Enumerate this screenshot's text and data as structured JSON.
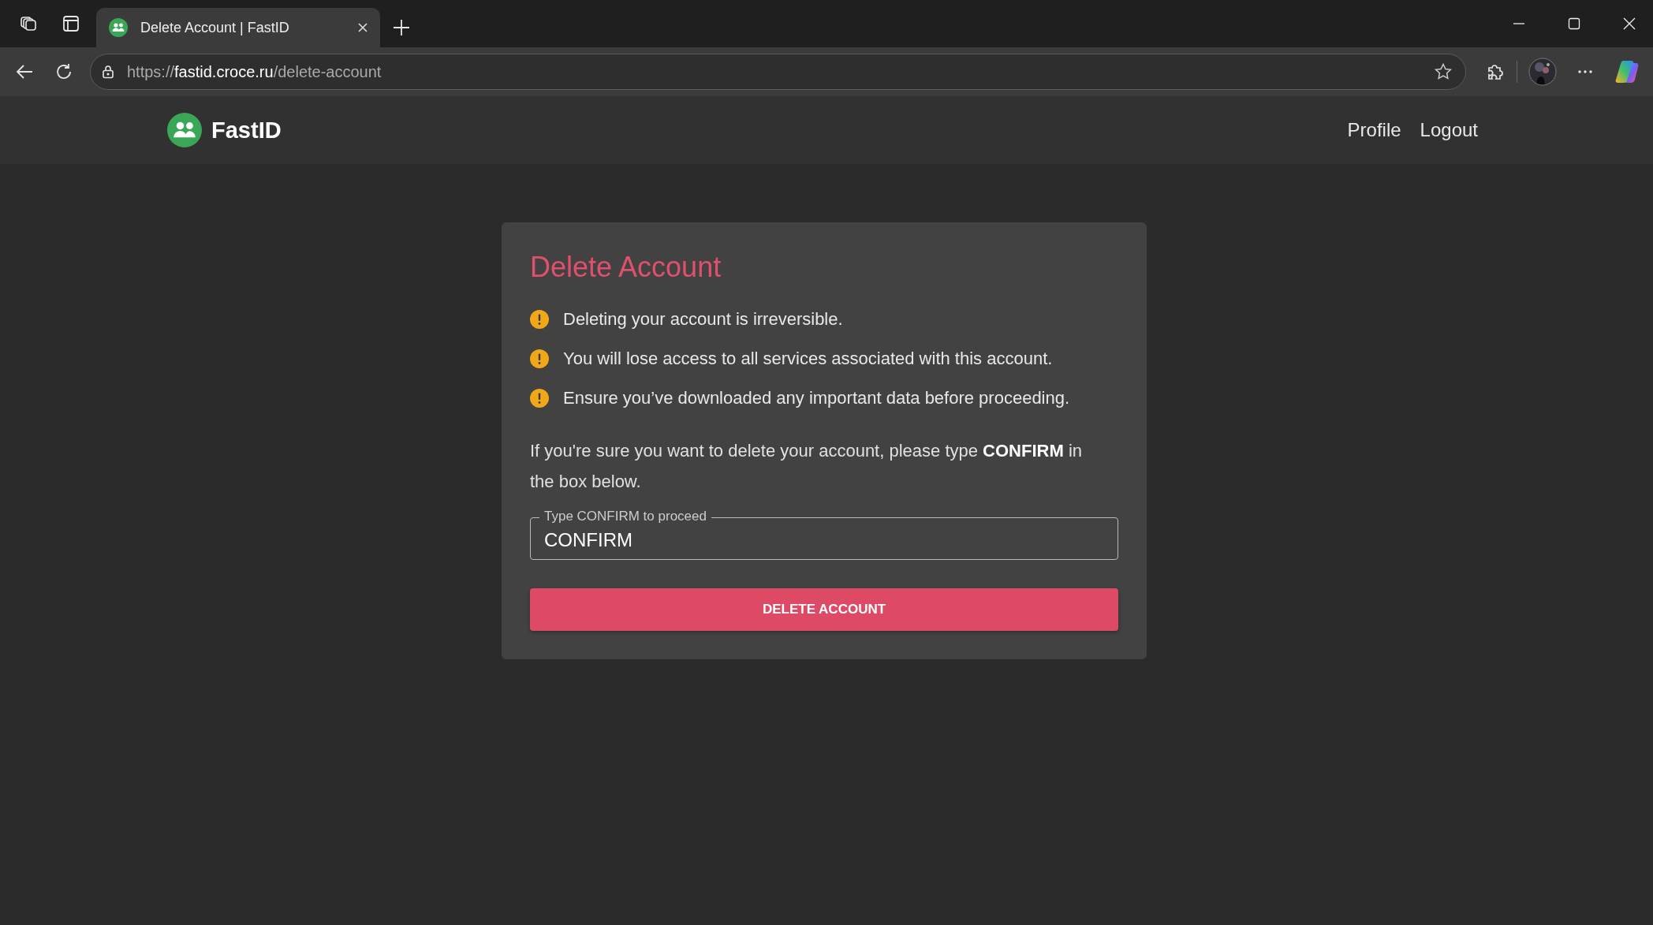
{
  "browser": {
    "tab": {
      "title": "Delete Account | FastID",
      "selected": true
    },
    "url": {
      "scheme": "https://",
      "host": "fastid.croce.ru",
      "path": "/delete-account"
    }
  },
  "header": {
    "brand": "FastID",
    "nav": [
      {
        "label": "Profile"
      },
      {
        "label": "Logout"
      }
    ]
  },
  "card": {
    "title": "Delete Account",
    "warnings": [
      "Deleting your account is irreversible.",
      "You will lose access to all services associated with this account.",
      "Ensure you’ve downloaded any important data before proceeding."
    ],
    "instruction": "If you're sure you want to delete your account, please type **CONFIRM** in the box below.",
    "field": {
      "label": "Type CONFIRM to proceed",
      "value": "CONFIRM"
    },
    "button": "DELETE ACCOUNT"
  }
}
